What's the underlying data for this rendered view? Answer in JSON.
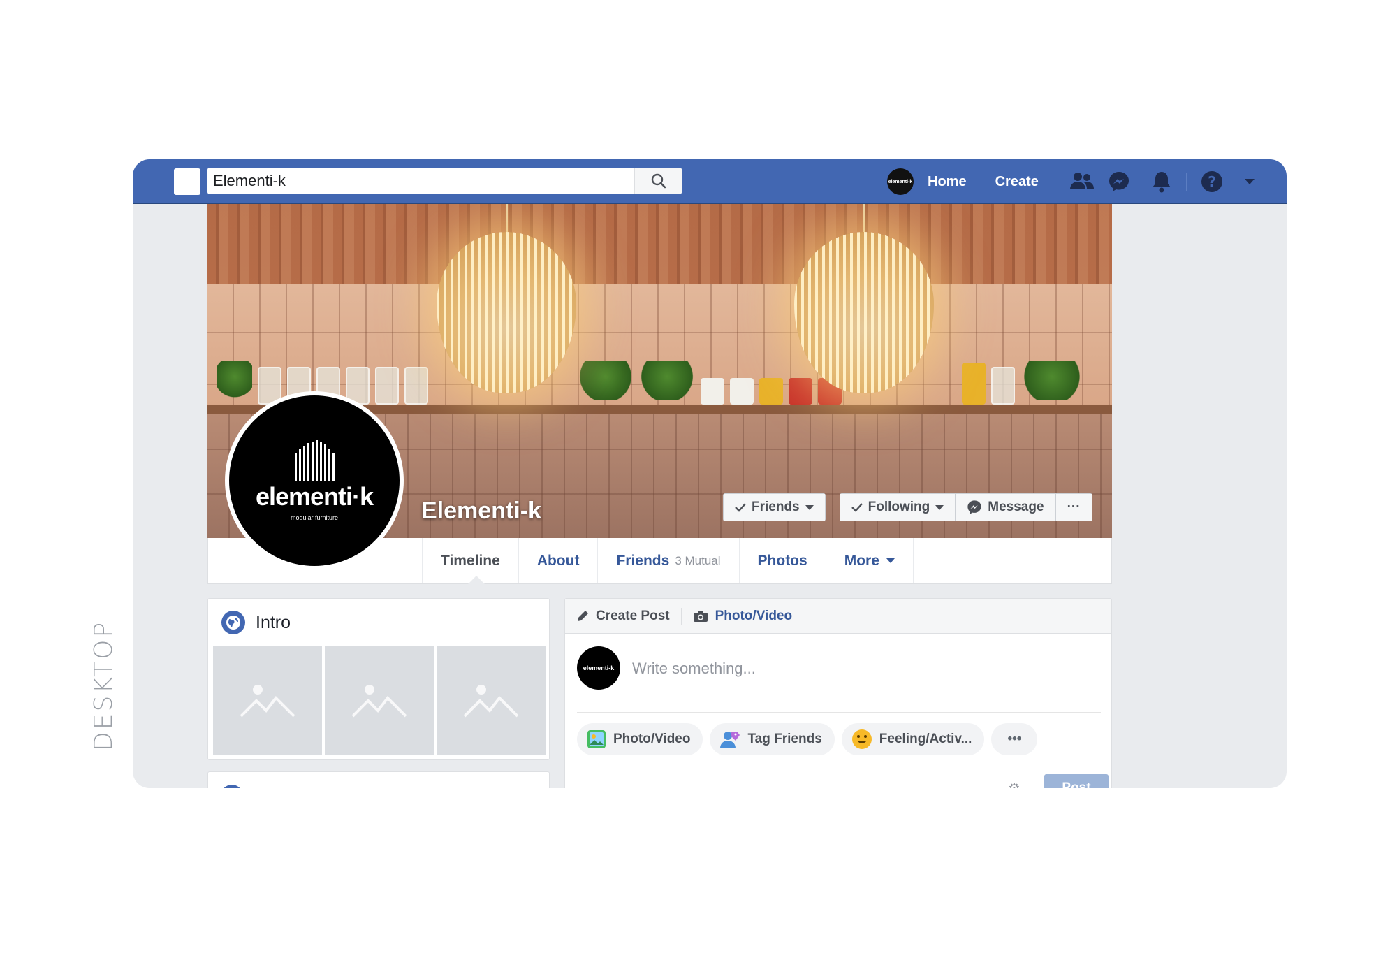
{
  "side_label": "DESKTOP",
  "search": {
    "value": "Elementi-k"
  },
  "nav": {
    "avatar_text": "elementi-k",
    "home": "Home",
    "create": "Create"
  },
  "profile": {
    "name": "Elementi-k",
    "logo_word": "elementi·k",
    "logo_sub": "modular furniture"
  },
  "cover_actions": {
    "friends": "Friends",
    "following": "Following",
    "message": "Message",
    "more": "···"
  },
  "tabs": {
    "timeline": "Timeline",
    "about": "About",
    "friends": "Friends",
    "friends_mutual": "3 Mutual",
    "photos": "Photos",
    "more": "More"
  },
  "intro": {
    "title": "Intro"
  },
  "composer": {
    "create_post": "Create Post",
    "photo_video_tab": "Photo/Video",
    "avatar_text": "elementi-k",
    "placeholder": "Write something...",
    "chip_photo": "Photo/Video",
    "chip_tag": "Tag Friends",
    "chip_feeling": "Feeling/Activ...",
    "chip_more": "•••",
    "post": "Post"
  },
  "colors": {
    "brand_blue": "#4267b2",
    "link_blue": "#365899",
    "page_bg": "#e9ebee"
  }
}
